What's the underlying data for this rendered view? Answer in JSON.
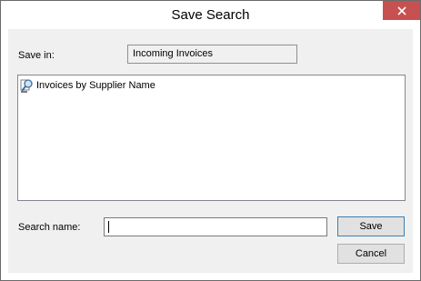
{
  "window": {
    "title": "Save Search",
    "close_icon": "close-icon"
  },
  "form": {
    "save_in_label": "Save in:",
    "save_in_value": "Incoming Invoices",
    "searches": [
      {
        "label": "Invoices by Supplier Name",
        "icon": "saved-search-icon"
      }
    ],
    "search_name_label": "Search name:",
    "search_name_value": "",
    "search_name_placeholder": ""
  },
  "buttons": {
    "save_label": "Save",
    "cancel_label": "Cancel"
  },
  "colors": {
    "close_button": "#c75050",
    "dialog_background": "#f0f0f0",
    "default_button_border": "#3c7fb1"
  }
}
